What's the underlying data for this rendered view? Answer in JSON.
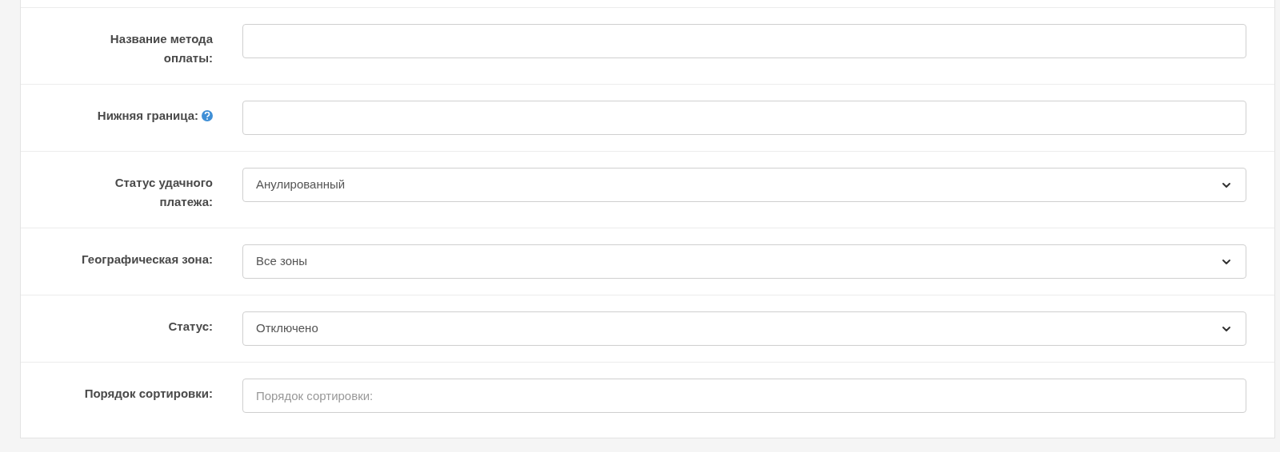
{
  "fields": [
    {
      "kind": "text",
      "label": "Название метода оплаты:"
    },
    {
      "kind": "text",
      "label": "Нижняя граница:",
      "help": true
    },
    {
      "kind": "select",
      "label": "Статус удачного платежа:",
      "value": "Анулированный"
    },
    {
      "kind": "select",
      "label": "Географическая зона:",
      "value": "Все зоны"
    },
    {
      "kind": "select",
      "label": "Статус:",
      "value": "Отключено"
    },
    {
      "kind": "text",
      "label": "Порядок сортировки:",
      "placeholder": "Порядок сортировки:"
    }
  ]
}
